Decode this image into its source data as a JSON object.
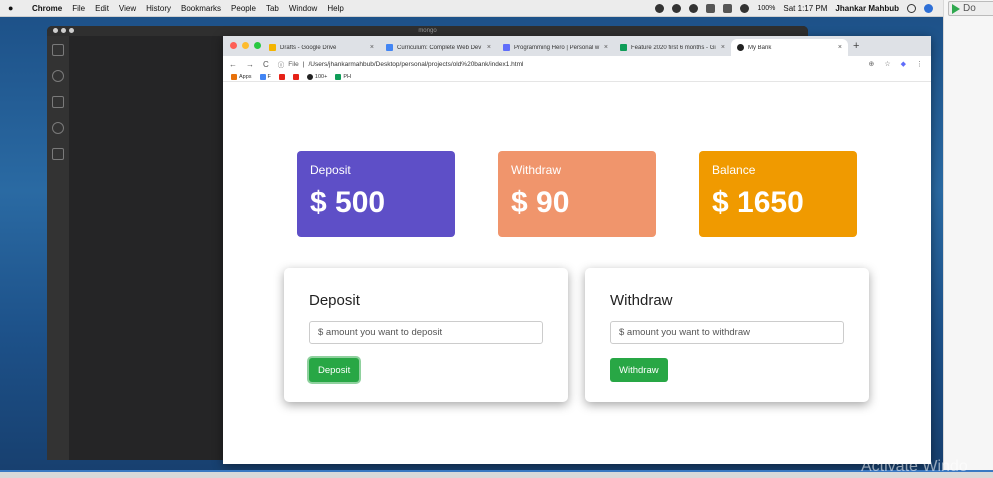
{
  "menubar": {
    "app": "Chrome",
    "items": [
      "File",
      "Edit",
      "View",
      "History",
      "Bookmarks",
      "People",
      "Tab",
      "Window",
      "Help"
    ],
    "battery": "100%",
    "clock": "Sat 1:17 PM",
    "user": "Jhankar Mahbub"
  },
  "side_window": {
    "button_label": "Do"
  },
  "vscode": {
    "title": "mongo"
  },
  "chrome": {
    "tabs": [
      {
        "title": "Drafts - Google Drive",
        "fav_color": "#f4b400"
      },
      {
        "title": "Curriculum: Complete Web Dev",
        "fav_color": "#4285f4"
      },
      {
        "title": "Programming Hero | Personal w",
        "fav_color": "#5f6dfa"
      },
      {
        "title": "Feature 2020 first 6 months - Gi",
        "fav_color": "#0f9d58"
      },
      {
        "title": "My Bank",
        "fav_color": "#222222"
      }
    ],
    "url_scheme": "File",
    "url": "/Users/jhankarmahbub/Desktop/personal/projects/old%20bank/index1.html",
    "bookmarks": [
      "Apps",
      "F",
      "",
      "",
      "100+",
      "PH"
    ]
  },
  "bank": {
    "deposit_card": {
      "label": "Deposit",
      "value": "$ 500",
      "color": "#5e4fc7"
    },
    "withdraw_card": {
      "label": "Withdraw",
      "value": "$ 90",
      "color": "#f0956c"
    },
    "balance_card": {
      "label": "Balance",
      "value": "$ 1650",
      "color": "#f09a00"
    },
    "deposit_form": {
      "title": "Deposit",
      "placeholder": "$ amount you want to deposit",
      "button": "Deposit"
    },
    "withdraw_form": {
      "title": "Withdraw",
      "placeholder": "$ amount you want to withdraw",
      "button": "Withdraw"
    }
  },
  "watermark": "Activate Windo"
}
